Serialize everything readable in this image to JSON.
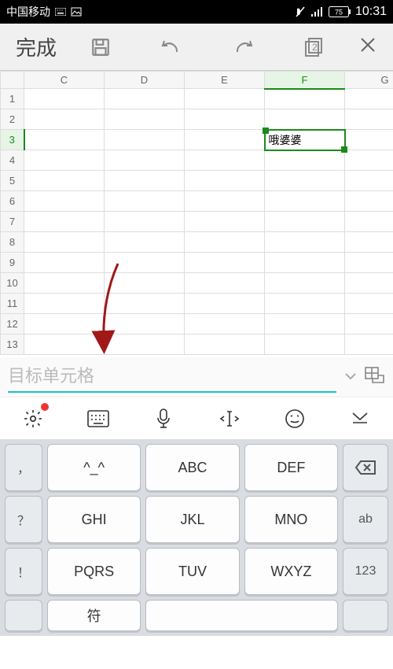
{
  "status": {
    "carrier": "中国移动",
    "battery": "75",
    "time": "10:31"
  },
  "toolbar": {
    "done": "完成",
    "sheet_count": "2"
  },
  "spreadsheet": {
    "columns": [
      "C",
      "D",
      "E",
      "F",
      "G"
    ],
    "rows": [
      "1",
      "2",
      "3",
      "4",
      "5",
      "6",
      "7",
      "8",
      "9",
      "10",
      "11",
      "12",
      "13"
    ],
    "active_col": "F",
    "active_row": "3",
    "cell_value": "哦婆婆"
  },
  "input_bar": {
    "placeholder": "目标单元格"
  },
  "keyboard": {
    "left_col": [
      "，",
      "？",
      "！"
    ],
    "rows": [
      [
        "^_^",
        "ABC",
        "DEF"
      ],
      [
        "GHI",
        "JKL",
        "MNO"
      ],
      [
        "PQRS",
        "TUV",
        "WXYZ"
      ]
    ],
    "right_col": [
      "ab",
      "123"
    ],
    "bottom_center": "符"
  }
}
